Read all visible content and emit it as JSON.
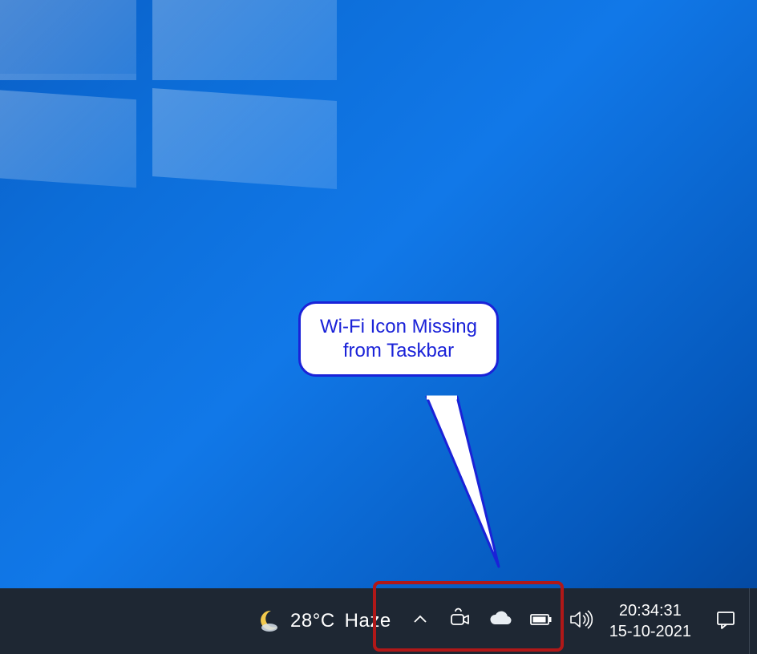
{
  "annotation": {
    "text": "Wi-Fi Icon Missing from Taskbar"
  },
  "taskbar": {
    "weather": {
      "temperature": "28°C",
      "condition": "Haze"
    },
    "datetime": {
      "time": "20:34:31",
      "date": "15-10-2021"
    }
  },
  "colors": {
    "callout_border": "#1a22d8",
    "highlight_border": "#b01818",
    "taskbar_bg": "#1e2733"
  }
}
